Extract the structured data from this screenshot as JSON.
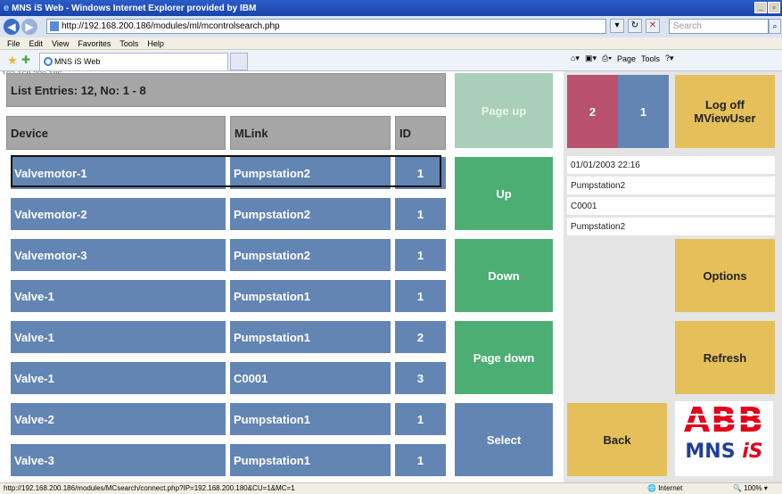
{
  "browser": {
    "title": "MNS iS Web - Windows Internet Explorer provided by IBM",
    "url": "http://192.168.200.186/modules/ml/mcontrolsearch.php",
    "search_placeholder": "Search",
    "menu": [
      "File",
      "Edit",
      "View",
      "Favorites",
      "Tools",
      "Help"
    ],
    "tab_label": "MNS iS Web",
    "command_items": [
      "Page",
      "Tools"
    ],
    "status_url": "http://192.168.200.186/modules/MCsearch/connect.php?IP=192.168.200.180&CU=1&MC=1",
    "status_zone": "Internet",
    "status_zoom": "100%"
  },
  "list": {
    "header_ghost": "192.168.200.186",
    "entries_label": "List Entries: 12, No: 1 - 8",
    "columns": {
      "device": "Device",
      "mlink": "MLink",
      "id": "ID"
    },
    "rows": [
      {
        "device": "Valvemotor-1",
        "mlink": "Pumpstation2",
        "id": "1"
      },
      {
        "device": "Valvemotor-2",
        "mlink": "Pumpstation2",
        "id": "1"
      },
      {
        "device": "Valvemotor-3",
        "mlink": "Pumpstation2",
        "id": "1"
      },
      {
        "device": "Valve-1",
        "mlink": "Pumpstation1",
        "id": "1"
      },
      {
        "device": "Valve-1",
        "mlink": "Pumpstation1",
        "id": "2"
      },
      {
        "device": "Valve-1",
        "mlink": "C0001",
        "id": "3"
      },
      {
        "device": "Valve-2",
        "mlink": "Pumpstation1",
        "id": "1"
      },
      {
        "device": "Valve-3",
        "mlink": "Pumpstation1",
        "id": "1"
      }
    ]
  },
  "nav": {
    "page_up": "Page up",
    "up": "Up",
    "down": "Down",
    "page_down": "Page down",
    "select": "Select"
  },
  "panel": {
    "count_a": "2",
    "count_b": "1",
    "logoff": "Log off",
    "user": "MViewUser",
    "info": [
      "01/01/2003 22:16",
      "Pumpstation2",
      "C0001",
      "Pumpstation2"
    ],
    "options": "Options",
    "refresh": "Refresh",
    "back": "Back",
    "logo_top": "ABB",
    "logo_bottom_a": "MNS ",
    "logo_bottom_b": "iS"
  }
}
